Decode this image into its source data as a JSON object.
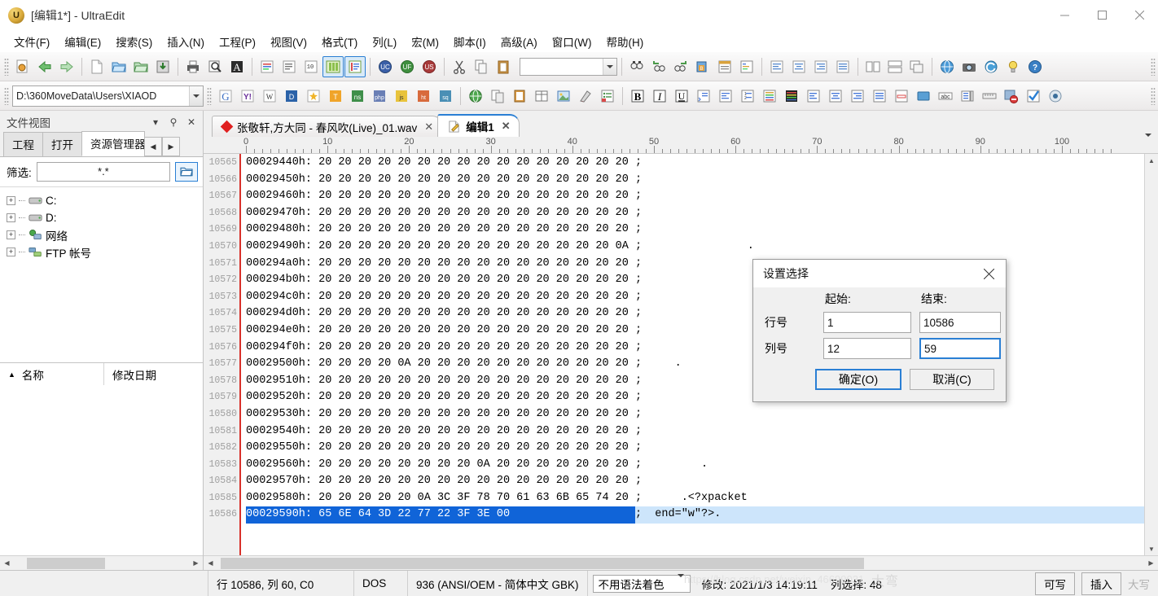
{
  "window": {
    "title": "[编辑1*] - UltraEdit",
    "app_icon": "ultraedit-logo-icon",
    "minimize": "–",
    "maximize": "□",
    "close": "✕"
  },
  "menubar": [
    {
      "label": "文件(F)"
    },
    {
      "label": "编辑(E)"
    },
    {
      "label": "搜索(S)"
    },
    {
      "label": "插入(N)"
    },
    {
      "label": "工程(P)"
    },
    {
      "label": "视图(V)"
    },
    {
      "label": "格式(T)"
    },
    {
      "label": "列(L)"
    },
    {
      "label": "宏(M)"
    },
    {
      "label": "脚本(I)"
    },
    {
      "label": "高级(A)"
    },
    {
      "label": "窗口(W)"
    },
    {
      "label": "帮助(H)"
    }
  ],
  "toolbar1": {
    "combo_value": "",
    "buttons": [
      "open-recent-icon",
      "back-arrow-icon",
      "forward-arrow-icon",
      "new-file-icon",
      "open-folder-icon",
      "open-project-icon",
      "save-icon",
      "print-icon",
      "print-preview-icon",
      "font-icon",
      "word-wrap-icon",
      "line-numbers-icon",
      "hex-edit-icon",
      "column-mode-icon",
      "uc-icon",
      "uf-icon",
      "us-icon",
      "cut-icon",
      "copy-icon",
      "paste-icon",
      "find-icon",
      "find-prev-icon",
      "find-next-icon",
      "bookmark-icon",
      "toggle-panel-icon",
      "list-icon",
      "align-left-icon",
      "align-center-icon",
      "align-right-icon",
      "justify-icon",
      "split-window-icon",
      "tile-window-icon",
      "cascade-window-icon",
      "browser-icon",
      "snapshot-icon",
      "refresh-icon",
      "tip-icon",
      "help-icon"
    ]
  },
  "toolbar2": {
    "path_value": "D:\\360MoveData\\Users\\XIAOD",
    "buttons": [
      "google-icon",
      "yahoo-icon",
      "wikipedia-icon",
      "dictionary-icon",
      "new-tip-icon",
      "translate-icon",
      "ins-icon",
      "php-icon",
      "js-icon",
      "html-icon",
      "sql-icon",
      "globe-icon",
      "copy-page-icon",
      "paste-page-icon",
      "table-icon",
      "insert-image-icon",
      "color-picker-icon",
      "list-bullet-icon",
      "templates-icon",
      "bold-icon",
      "italic-icon",
      "underline-icon",
      "indent-tag-icon",
      "align-tag-icon",
      "number-tag-icon",
      "stripe-icon",
      "gradient-icon",
      "para-left-icon",
      "para-center-icon",
      "para-right-icon",
      "para-justify-icon",
      "form-field-icon",
      "window-icon",
      "textbox-icon",
      "listbox-icon",
      "ruler-icon",
      "no-entry-icon",
      "checkbox-icon",
      "radio-icon"
    ]
  },
  "sidebar": {
    "title": "文件视图",
    "header_actions": [
      "chevron-down-icon",
      "pin-icon",
      "close-icon"
    ],
    "tabs": [
      {
        "label": "工程",
        "selected": false
      },
      {
        "label": "打开",
        "selected": false
      },
      {
        "label": "资源管理器",
        "selected": true
      }
    ],
    "tab_nav": [
      "◀",
      "▶"
    ],
    "filter": {
      "label": "筛选:",
      "value": "*.*",
      "button_icon": "open-folder-icon"
    },
    "tree": [
      {
        "label": "C:",
        "icon": "drive-icon"
      },
      {
        "label": "D:",
        "icon": "drive-icon"
      },
      {
        "label": "网络",
        "icon": "network-icon"
      },
      {
        "label": "FTP 帐号",
        "icon": "ftp-icon"
      }
    ],
    "list_headers": [
      {
        "label": "名称",
        "sort": "▲"
      },
      {
        "label": "修改日期",
        "sort": ""
      }
    ]
  },
  "editor": {
    "tabs": [
      {
        "label": "张敬轩,方大同 - 春风吹(Live)_01.wav",
        "icon": "red-diamond-icon",
        "close": "✕",
        "selected": false
      },
      {
        "label": "编辑1",
        "icon": "edit-document-icon",
        "close": "✕",
        "selected": true
      }
    ],
    "ruler_marks": [
      "0",
      "10",
      "20",
      "30",
      "40",
      "50",
      "60",
      "70",
      "80",
      "90",
      "100"
    ],
    "hex_lines": [
      {
        "num": "10565",
        "addr": "00029440h:",
        "bytes": "20 20 20 20 20 20 20 20 20 20 20 20 20 20 20 20",
        "ascii": "",
        "selected": false
      },
      {
        "num": "10566",
        "addr": "00029450h:",
        "bytes": "20 20 20 20 20 20 20 20 20 20 20 20 20 20 20 20",
        "ascii": "",
        "selected": false
      },
      {
        "num": "10567",
        "addr": "00029460h:",
        "bytes": "20 20 20 20 20 20 20 20 20 20 20 20 20 20 20 20",
        "ascii": "",
        "selected": false
      },
      {
        "num": "10568",
        "addr": "00029470h:",
        "bytes": "20 20 20 20 20 20 20 20 20 20 20 20 20 20 20 20",
        "ascii": "",
        "selected": false
      },
      {
        "num": "10569",
        "addr": "00029480h:",
        "bytes": "20 20 20 20 20 20 20 20 20 20 20 20 20 20 20 20",
        "ascii": "",
        "selected": false
      },
      {
        "num": "10570",
        "addr": "00029490h:",
        "bytes": "20 20 20 20 20 20 20 20 20 20 20 20 20 20 20 0A",
        "ascii": "               .",
        "selected": false
      },
      {
        "num": "10571",
        "addr": "000294a0h:",
        "bytes": "20 20 20 20 20 20 20 20 20 20 20 20 20 20 20 20",
        "ascii": "",
        "selected": false
      },
      {
        "num": "10572",
        "addr": "000294b0h:",
        "bytes": "20 20 20 20 20 20 20 20 20 20 20 20 20 20 20 20",
        "ascii": "",
        "selected": false
      },
      {
        "num": "10573",
        "addr": "000294c0h:",
        "bytes": "20 20 20 20 20 20 20 20 20 20 20 20 20 20 20 20",
        "ascii": "",
        "selected": false
      },
      {
        "num": "10574",
        "addr": "000294d0h:",
        "bytes": "20 20 20 20 20 20 20 20 20 20 20 20 20 20 20 20",
        "ascii": "",
        "selected": false
      },
      {
        "num": "10575",
        "addr": "000294e0h:",
        "bytes": "20 20 20 20 20 20 20 20 20 20 20 20 20 20 20 20",
        "ascii": "",
        "selected": false
      },
      {
        "num": "10576",
        "addr": "000294f0h:",
        "bytes": "20 20 20 20 20 20 20 20 20 20 20 20 20 20 20 20",
        "ascii": "",
        "selected": false
      },
      {
        "num": "10577",
        "addr": "00029500h:",
        "bytes": "20 20 20 20 0A 20 20 20 20 20 20 20 20 20 20 20",
        "ascii": "    .",
        "selected": false
      },
      {
        "num": "10578",
        "addr": "00029510h:",
        "bytes": "20 20 20 20 20 20 20 20 20 20 20 20 20 20 20 20",
        "ascii": "",
        "selected": false
      },
      {
        "num": "10579",
        "addr": "00029520h:",
        "bytes": "20 20 20 20 20 20 20 20 20 20 20 20 20 20 20 20",
        "ascii": "",
        "selected": false
      },
      {
        "num": "10580",
        "addr": "00029530h:",
        "bytes": "20 20 20 20 20 20 20 20 20 20 20 20 20 20 20 20",
        "ascii": "",
        "selected": false
      },
      {
        "num": "10581",
        "addr": "00029540h:",
        "bytes": "20 20 20 20 20 20 20 20 20 20 20 20 20 20 20 20",
        "ascii": "",
        "selected": false
      },
      {
        "num": "10582",
        "addr": "00029550h:",
        "bytes": "20 20 20 20 20 20 20 20 20 20 20 20 20 20 20 20",
        "ascii": "",
        "selected": false
      },
      {
        "num": "10583",
        "addr": "00029560h:",
        "bytes": "20 20 20 20 20 20 20 20 0A 20 20 20 20 20 20 20",
        "ascii": "        .",
        "selected": false
      },
      {
        "num": "10584",
        "addr": "00029570h:",
        "bytes": "20 20 20 20 20 20 20 20 20 20 20 20 20 20 20 20",
        "ascii": "",
        "selected": false
      },
      {
        "num": "10585",
        "addr": "00029580h:",
        "bytes": "20 20 20 20 20 0A 3C 3F 78 70 61 63 6B 65 74 20",
        "ascii": "     .<?xpacket ",
        "selected": false
      },
      {
        "num": "10586",
        "addr": "00029590h:",
        "bytes": "65 6E 64 3D 22 77 22 3F 3E 00",
        "ascii": " end=\"w\"?>.",
        "selected": true
      }
    ]
  },
  "statusbar": {
    "position": "行 10586, 列 60, C0",
    "line_ending": "DOS",
    "codepage": "936   (ANSI/OEM - 简体中文 GBK)",
    "syntax": "不用语法着色",
    "modified": "修改: 2021/1/3 14:19:11",
    "column_select": "列选择: 48",
    "writable": "可写",
    "insert_mode": "插入",
    "caps": "大写"
  },
  "dialog": {
    "title": "设置选择",
    "close": "✕",
    "col_headers": [
      "起始:",
      "结束:"
    ],
    "rows": [
      {
        "label": "行号",
        "start": "1",
        "end": "10586"
      },
      {
        "label": "列号",
        "start": "12",
        "end": "59"
      }
    ],
    "focused_field": "col-end",
    "ok": "确定(O)",
    "cancel": "取消(C)"
  },
  "watermark": "大弯",
  "watermark2": "https://blog.csdn.net/weixin_46699031",
  "colors": {
    "accent": "#2a7fd4",
    "selection_bg": "#1064d8",
    "selection_row": "#cde5fb",
    "gutter_rule": "#d8312a",
    "chrome": "#f0f0f0"
  }
}
